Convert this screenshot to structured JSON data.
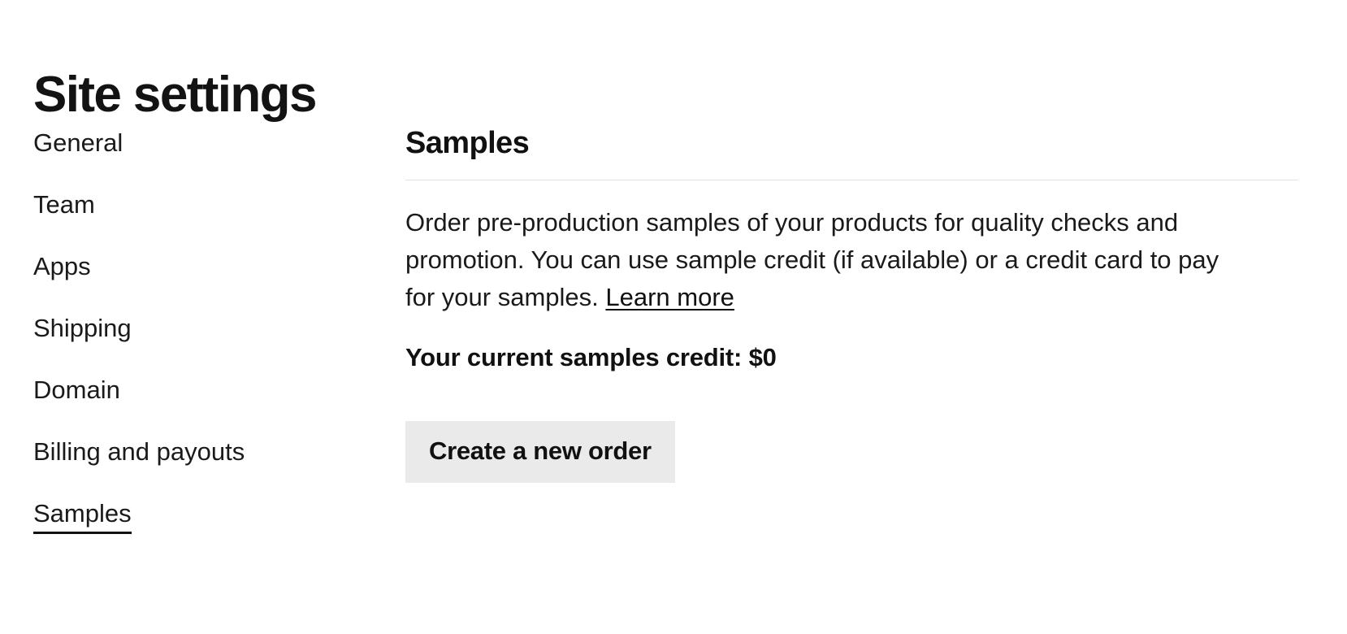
{
  "page": {
    "title": "Site settings"
  },
  "sidebar": {
    "items": [
      {
        "label": "General",
        "active": false
      },
      {
        "label": "Team",
        "active": false
      },
      {
        "label": "Apps",
        "active": false
      },
      {
        "label": "Shipping",
        "active": false
      },
      {
        "label": "Domain",
        "active": false
      },
      {
        "label": "Billing and payouts",
        "active": false
      },
      {
        "label": "Samples",
        "active": true
      }
    ]
  },
  "main": {
    "section_title": "Samples",
    "description_part1": "Order pre-production samples of your products for quality checks and promotion. You can use sample credit (if available) or a credit card to pay for your samples. ",
    "learn_more_label": "Learn more",
    "credit_label": "Your current samples credit: $0",
    "create_order_button": "Create a new order"
  },
  "colors": {
    "text": "#111111",
    "button_background": "#eaeaea",
    "divider": "#e2e2e2",
    "page_background": "#ffffff"
  }
}
